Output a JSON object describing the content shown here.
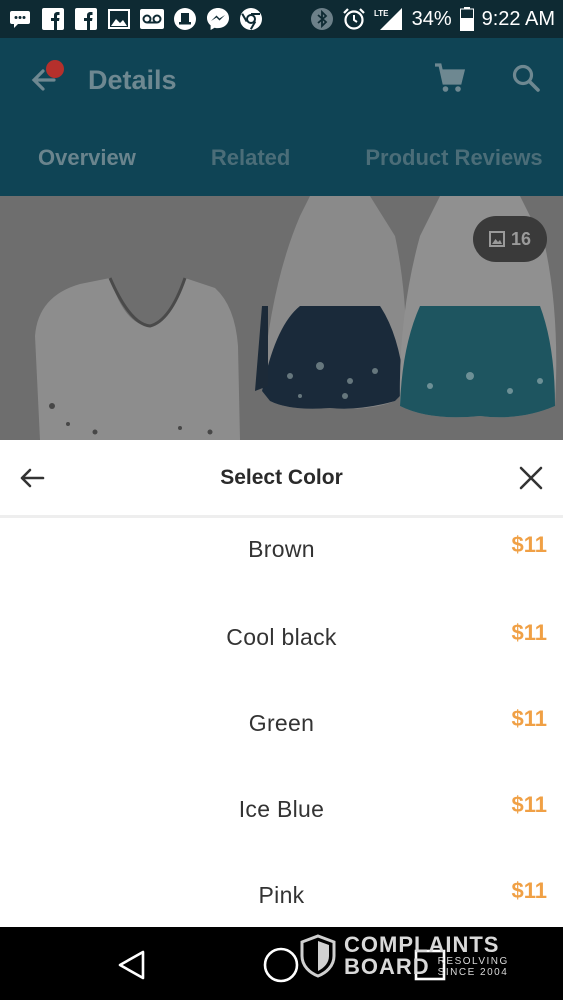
{
  "status_bar": {
    "battery": "34%",
    "time": "9:22 AM",
    "network": "LTE",
    "icons": [
      "chat-icon",
      "facebook-icon",
      "facebook-icon",
      "image-icon",
      "voicemail-icon",
      "hat-icon",
      "messenger-icon",
      "chrome-icon",
      "bluetooth-icon",
      "alarm-icon",
      "signal-icon",
      "battery-icon"
    ]
  },
  "app_bar": {
    "title": "Details",
    "tabs": [
      {
        "label": "Overview",
        "active": true
      },
      {
        "label": "Related",
        "active": false
      },
      {
        "label": "Product Reviews",
        "active": false
      }
    ]
  },
  "product": {
    "image_count": "16"
  },
  "sheet": {
    "title": "Select Color",
    "options": [
      {
        "name": "Brown",
        "price": "$11"
      },
      {
        "name": "Cool black",
        "price": "$11"
      },
      {
        "name": "Green",
        "price": "$11"
      },
      {
        "name": "Ice Blue",
        "price": "$11"
      },
      {
        "name": "Pink",
        "price": "$11"
      }
    ]
  },
  "watermark": {
    "line1": "COMPLAINTS",
    "line2": "BOARD",
    "tagline_1": "RESOLVING",
    "tagline_2": "SINCE 2004"
  },
  "colors": {
    "accent": "#0f4455",
    "price": "#f0a045",
    "status_bar": "#0e2a33"
  }
}
